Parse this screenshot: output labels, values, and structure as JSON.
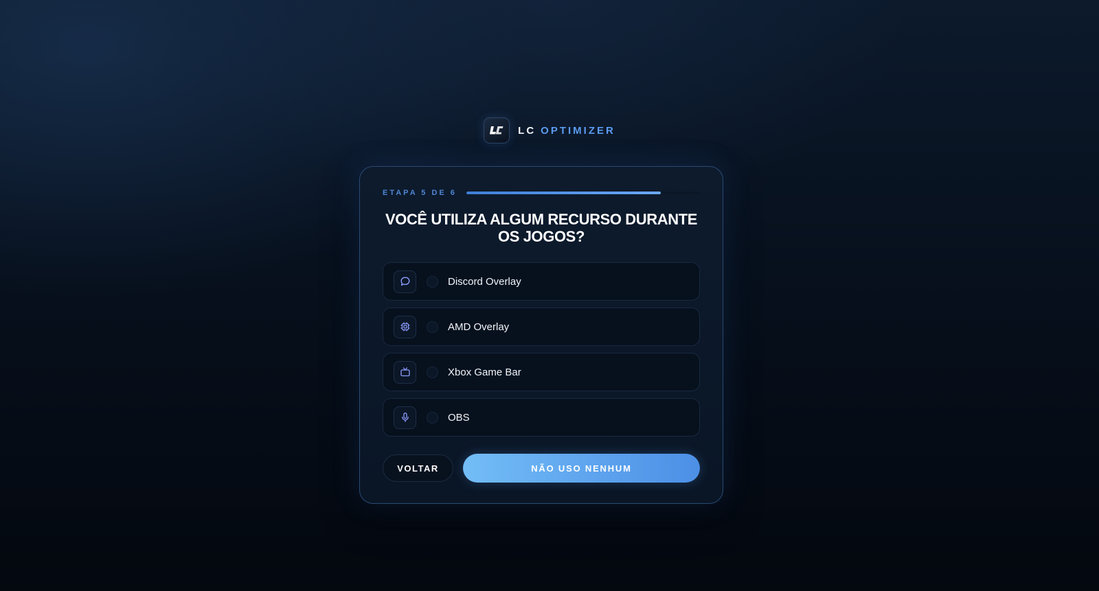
{
  "brand": {
    "name_primary": "LC",
    "name_secondary": "OPTIMIZER",
    "logo_icon": "lc-logo-icon"
  },
  "colors": {
    "accent": "#5b9bf0",
    "button_gradient_start": "#73bdf7",
    "button_gradient_end": "#4c8fe6",
    "card_border": "#2a4a73",
    "background": "#07101d"
  },
  "step": {
    "label": "ETAPA 5 DE 6",
    "current": 5,
    "total": 6,
    "progress_fraction": 0.8333
  },
  "question": {
    "text": "VOCÊ UTILIZA ALGUM RECURSO DURANTE OS JOGOS?"
  },
  "options": [
    {
      "label": "Discord Overlay",
      "icon": "chat-bubble-icon",
      "selected": false
    },
    {
      "label": "AMD Overlay",
      "icon": "chip-icon",
      "selected": false
    },
    {
      "label": "Xbox Game Bar",
      "icon": "tv-icon",
      "selected": false
    },
    {
      "label": "OBS",
      "icon": "microphone-icon",
      "selected": false
    }
  ],
  "actions": {
    "back_label": "VOLTAR",
    "primary_label": "NÃO USO NENHUM"
  }
}
